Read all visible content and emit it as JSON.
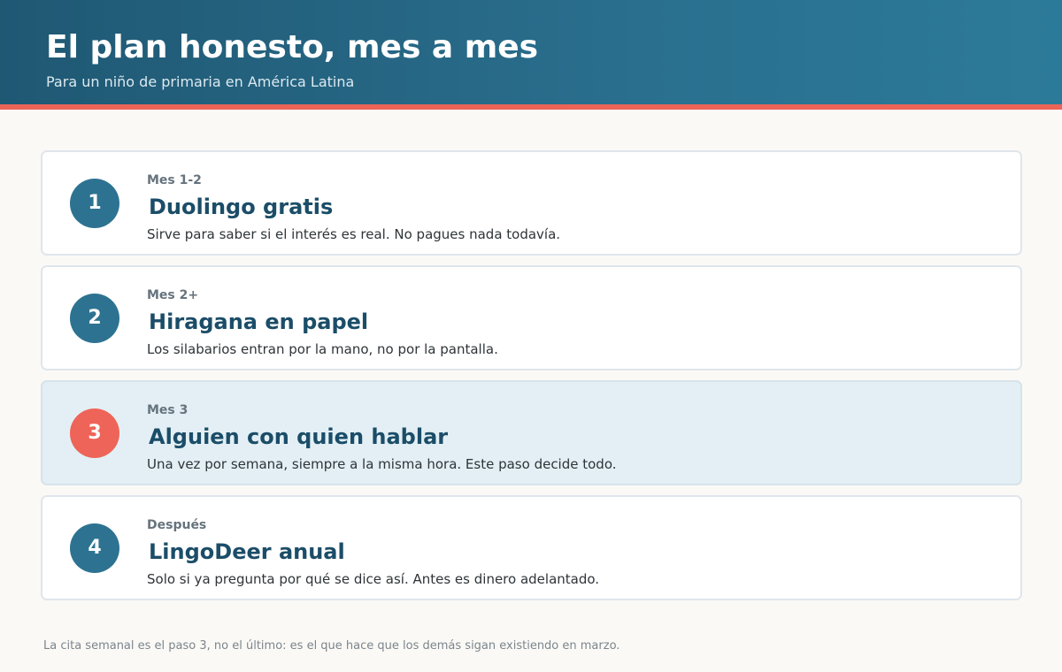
{
  "header": {
    "title": "El plan honesto, mes a mes",
    "subtitle": "Para un niño de primaria en América Latina"
  },
  "colors": {
    "header_bg": "#2a6f8e",
    "accent": "#ec6457",
    "badge": "#2d7391",
    "highlight_bg": "#e3eff5"
  },
  "steps": [
    {
      "number": "1",
      "period": "Mes 1-2",
      "title": "Duolingo gratis",
      "description": "Sirve para saber si el interés es real. No pagues nada todavía.",
      "highlighted": false
    },
    {
      "number": "2",
      "period": "Mes 2+",
      "title": "Hiragana en papel",
      "description": "Los silabarios entran por la mano, no por la pantalla.",
      "highlighted": false
    },
    {
      "number": "3",
      "period": "Mes 3",
      "title": "Alguien con quien hablar",
      "description": "Una vez por semana, siempre a la misma hora. Este paso decide todo.",
      "highlighted": true
    },
    {
      "number": "4",
      "period": "Después",
      "title": "LingoDeer anual",
      "description": "Solo si ya pregunta por qué se dice así. Antes es dinero adelantado.",
      "highlighted": false
    }
  ],
  "footnote": "La cita semanal es el paso 3, no el último: es el que hace que los demás sigan existiendo en marzo."
}
